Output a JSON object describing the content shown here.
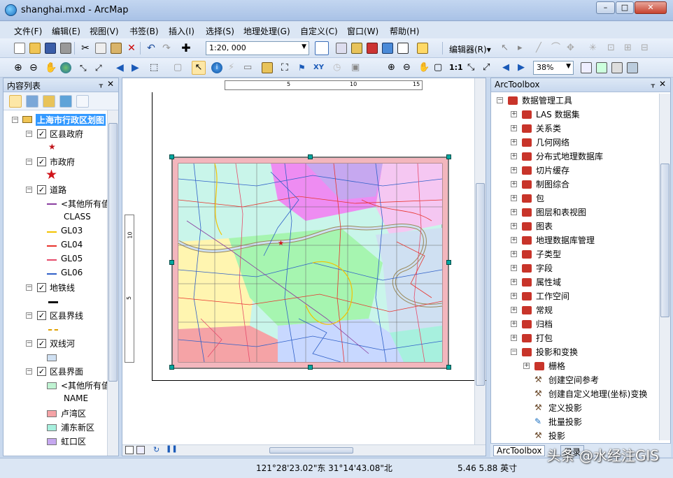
{
  "window": {
    "title": "shanghai.mxd - ArcMap",
    "min_label": "–",
    "max_label": "□",
    "close_label": "✕"
  },
  "menu": [
    "文件(F)",
    "编辑(E)",
    "视图(V)",
    "书签(B)",
    "插入(I)",
    "选择(S)",
    "地理处理(G)",
    "自定义(C)",
    "窗口(W)",
    "帮助(H)"
  ],
  "toolbar": {
    "scale": "1:20, 000",
    "editor_label": "编辑器(R)▾",
    "zoom_level": "38%"
  },
  "toc": {
    "title": "内容列表",
    "root": "上海市行政区划图",
    "layers": [
      {
        "name": "区县政府"
      },
      {
        "name": "市政府"
      },
      {
        "name": "道路",
        "legend": [
          "<其他所有值",
          "CLASS",
          "GL03",
          "GL04",
          "GL05",
          "GL06"
        ]
      },
      {
        "name": "地铁线"
      },
      {
        "name": "区县界线"
      },
      {
        "name": "双线河"
      },
      {
        "name": "区县界面",
        "legend": [
          "<其他所有值",
          "NAME",
          "卢湾区",
          "浦东新区",
          "虹口区"
        ]
      }
    ]
  },
  "ruler": {
    "h_ticks": [
      "5",
      "10",
      "15"
    ],
    "v_ticks": [
      "10",
      "5"
    ]
  },
  "arctoolbox": {
    "title": "ArcToolbox",
    "root": "数据管理工具",
    "items": [
      "LAS 数据集",
      "关系类",
      "几何网络",
      "分布式地理数据库",
      "切片缓存",
      "制图综合",
      "包",
      "图层和表视图",
      "图表",
      "地理数据库管理",
      "子类型",
      "字段",
      "属性域",
      "工作空间",
      "常规",
      "归档",
      "打包",
      "投影和变换"
    ],
    "sub_items": [
      "栅格",
      "创建空间参考",
      "创建自定义地理(坐标)变换",
      "定义投影",
      "批量投影",
      "投影"
    ],
    "tabs": [
      "ArcToolbox",
      "目录"
    ]
  },
  "status": {
    "coords": "121°28'23.02\"东  31°14'43.08\"北",
    "page_coords": "5.46  5.88 英寸"
  },
  "watermark": "头条 @水经注GIS",
  "colors": {
    "title_bar": "#c3d6f0",
    "selection": "#3399ff",
    "road_gl03": "#f3c300",
    "road_gl04": "#e8332c",
    "road_gl05": "#e64b6a",
    "road_gl06": "#3060c8",
    "road_other": "#8a3fa0",
    "county_other": "#bff3d2",
    "luwan": "#f5a3a6",
    "pudong": "#a7f0de",
    "hongkou": "#c6a8f0",
    "river": "#cfe0f2"
  }
}
